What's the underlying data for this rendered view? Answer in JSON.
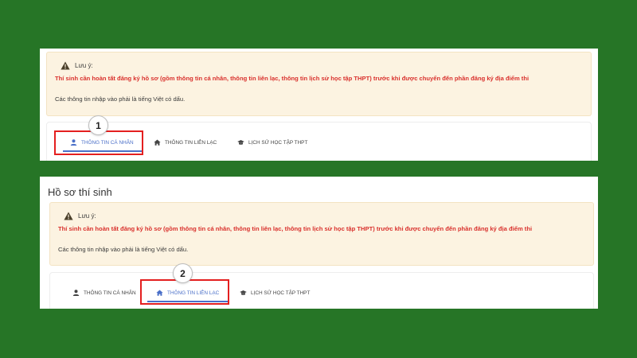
{
  "notice": {
    "label": "Lưu ý:",
    "warning": "Thí sinh cần hoàn tất đăng ký hồ sơ (gồm thông tin cá nhân, thông tin liên lạc, thông tin lịch sử học tập THPT) trước khi được chuyển đến phần đăng ký địa điểm thi",
    "info": "Các thông tin nhập vào phải là tiếng Việt có dấu."
  },
  "section_title": "Hồ sơ thí sinh",
  "tabs": [
    {
      "label": "THÔNG TIN CÁ NHÂN",
      "icon": "user-icon"
    },
    {
      "label": "THÔNG TIN LIÊN LẠC",
      "icon": "home-icon"
    },
    {
      "label": "LỊCH SỬ HỌC TẬP THPT",
      "icon": "graduation-cap-icon"
    }
  ],
  "callouts": [
    "1",
    "2"
  ],
  "colors": {
    "background": "#267526",
    "notice_bg": "#fcf3e1",
    "warning_text": "#d9302c",
    "active_tab": "#4a6fc8",
    "highlight": "#e41f1f"
  }
}
